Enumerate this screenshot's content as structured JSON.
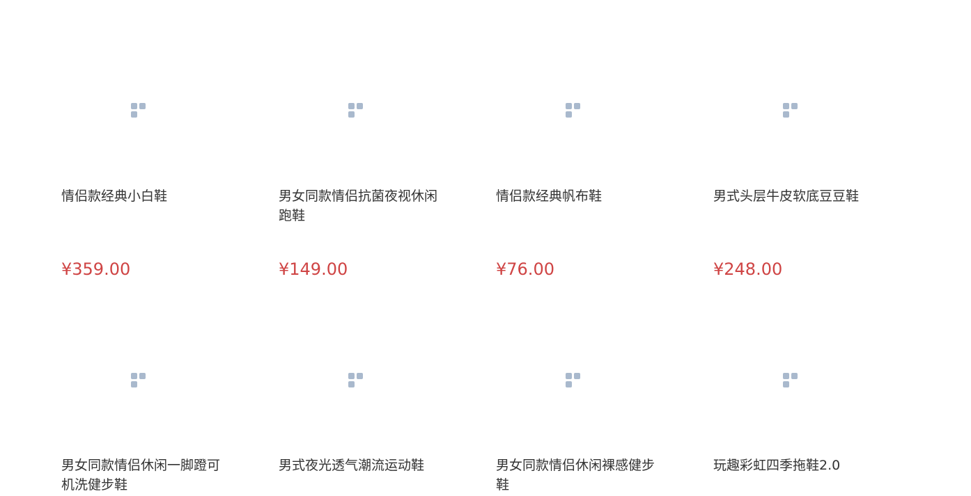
{
  "products": [
    {
      "name": "情侣款经典小白鞋",
      "price": "¥359.00",
      "image_icon": "image-placeholder-icon"
    },
    {
      "name": "男女同款情侣抗菌夜视休闲跑鞋",
      "price": "¥149.00",
      "image_icon": "image-placeholder-icon"
    },
    {
      "name": "情侣款经典帆布鞋",
      "price": "¥76.00",
      "image_icon": "image-placeholder-icon"
    },
    {
      "name": "男式头层牛皮软底豆豆鞋",
      "price": "¥248.00",
      "image_icon": "image-placeholder-icon"
    },
    {
      "name": "男女同款情侣休闲一脚蹬可机洗健步鞋",
      "price": "",
      "image_icon": "image-placeholder-icon"
    },
    {
      "name": "男式夜光透气潮流运动鞋",
      "price": "",
      "image_icon": "image-placeholder-icon"
    },
    {
      "name": "男女同款情侣休闲裸感健步鞋",
      "price": "",
      "image_icon": "image-placeholder-icon"
    },
    {
      "name": "玩趣彩虹四季拖鞋2.0",
      "price": "",
      "image_icon": "image-placeholder-icon"
    }
  ],
  "colors": {
    "price": "#cf4444",
    "name": "#333333",
    "placeholder_icon": "#a9b9cd"
  }
}
